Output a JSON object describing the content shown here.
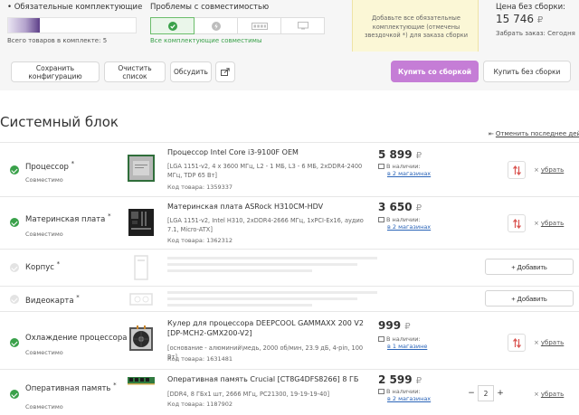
{
  "summary": {
    "required_title": "Обязательные комплектующие",
    "required_progress_text": "2/8",
    "required_progress_fraction": 0.25,
    "total_items": "Всего товаров в комплекте: 5",
    "compat_title": "Проблемы с совместимостью",
    "compat_icons": [
      "check-icon",
      "power-icon",
      "connector-icon",
      "monitor-icon"
    ],
    "compat_status": "Все комплектующие совместимы",
    "note": "Добавьте все обязательные комплектующие (отмечены звездочкой *) для заказа сборки",
    "price_label": "Цена без сборки:",
    "price_value": "15 746",
    "currency": "₽",
    "order_label": "Забрать заказ: Сегодня"
  },
  "actions": {
    "save": "Сохранить конфигурацию",
    "clear": "Очистить список",
    "discuss": "Обсудить",
    "buy_assembled": "Купить со сборкой",
    "buy_unassembled": "Купить без сборки"
  },
  "section": {
    "title": "Системный блок",
    "undo": "Отменить последнее действие"
  },
  "labels": {
    "compatible": "Совместимо",
    "in_stock": "В наличии:",
    "remove": "убрать",
    "add": "+ Добавить",
    "required_mark": "*"
  },
  "components": [
    {
      "category": "Процессор",
      "status": "Совместимо",
      "name": "Процессор Intel Core i3-9100F OEM",
      "specs": "[LGA 1151-v2, 4 x 3600 МГц, L2 - 1 МБ, L3 - 6 МБ, 2xDDR4-2400 МГц, TDP 65 Вт]",
      "code": "Код товара: 1359337",
      "price": "5 899",
      "stock": "в 2 магазинах"
    },
    {
      "category": "Материнская плата",
      "status": "Совместимо",
      "name": "Материнская плата ASRock H310CM-HDV",
      "specs": "[LGA 1151-v2, Intel H310, 2xDDR4-2666 МГц, 1xPCI-Ex16, аудио 7.1, Micro-ATX]",
      "code": "Код товара: 1362312",
      "price": "3 650",
      "stock": "в 2 магазинах"
    },
    {
      "category": "Корпус",
      "status": "",
      "name": "",
      "specs": "",
      "code": "",
      "price": "",
      "stock": ""
    },
    {
      "category": "Видеокарта",
      "status": "",
      "name": "",
      "specs": "",
      "code": "",
      "price": "",
      "stock": ""
    },
    {
      "category": "Охлаждение процессора",
      "status": "Совместимо",
      "name": "Кулер для процессора DEEPCOOL GAMMAXX 200 V2 [DP-MCH2-GMX200-V2]",
      "specs": "[основание - алюминий\\медь, 2000 об/мин, 23.9 дБ, 4-pin, 100 Вт]",
      "code": "Код товара: 1631481",
      "price": "999",
      "stock": "в 1 магазине"
    },
    {
      "category": "Оперативная память",
      "status": "Совместимо",
      "name": "Оперативная память Crucial [CT8G4DFS8266] 8 ГБ",
      "specs": "[DDR4, 8 ГБx1 шт, 2666 МГц, PC21300, 19-19-19-40]",
      "code": "Код товара: 1187902",
      "price": "2 599",
      "stock": "в 2 магазинах",
      "quantity": "2"
    }
  ],
  "colors": {
    "accent_purple": "#c57dd6",
    "success_green": "#3aa14a",
    "danger_red": "#d9534f",
    "link_blue": "#2a64b8",
    "note_yellow": "#fbf7d6"
  }
}
